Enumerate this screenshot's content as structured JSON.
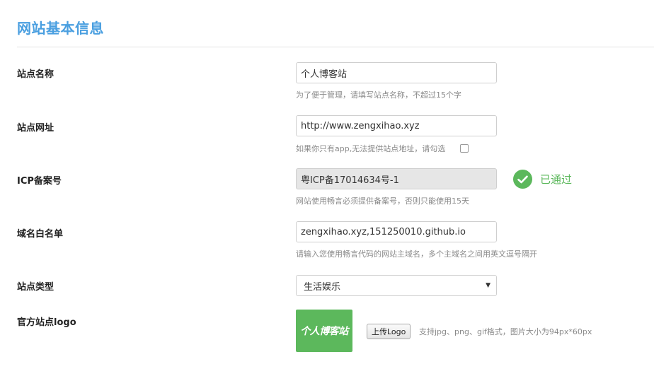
{
  "page": {
    "title": "网站基本信息"
  },
  "fields": {
    "site_name": {
      "label": "站点名称",
      "value": "个人博客站",
      "hint": "为了便于管理，请填写站点名称，不超过15个字"
    },
    "site_url": {
      "label": "站点网址",
      "value": "http://www.zengxihao.xyz",
      "hint": "如果你只有app,无法提供站点地址，请勾选",
      "checkbox_checked": false
    },
    "icp": {
      "label": "ICP备案号",
      "value": "粤ICP备17014634号-1",
      "hint": "网站使用畅言必须提供备案号，否则只能使用15天",
      "status_text": "已通过",
      "status_icon": "check-circle-icon"
    },
    "domain_whitelist": {
      "label": "域名白名单",
      "value": "zengxihao.xyz,151250010.github.io",
      "hint": "请输入您使用畅言代码的网站主域名，多个主域名之间用英文逗号隔开"
    },
    "site_type": {
      "label": "站点类型",
      "selected": "生活娱乐"
    },
    "logo": {
      "label": "官方站点logo",
      "logo_text": "个人博客站",
      "upload_label": "上传Logo",
      "hint": "支持jpg、png、gif格式，图片大小为94px*60px"
    }
  },
  "colors": {
    "title": "#4a9fe0",
    "success": "#5cb85c",
    "hint": "#8a8a8a"
  }
}
